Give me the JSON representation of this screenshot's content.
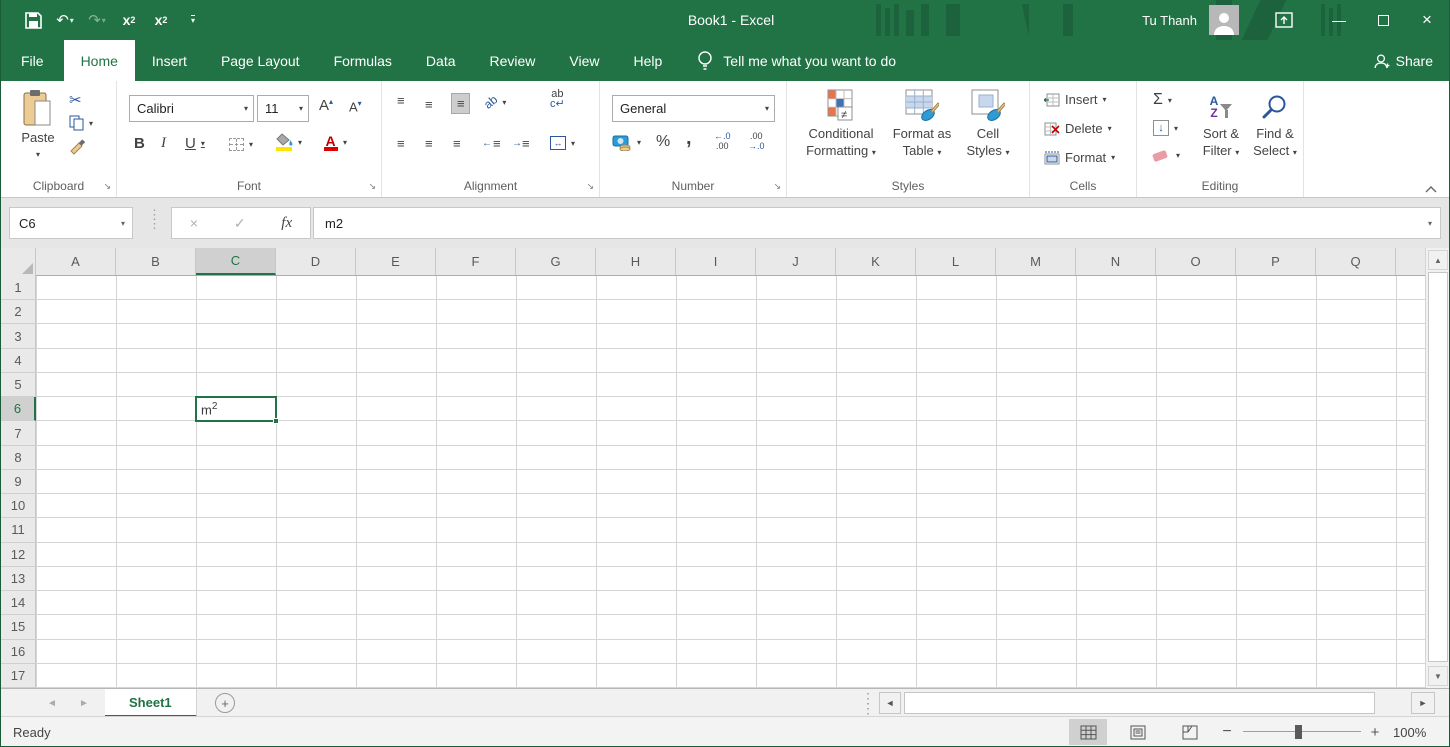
{
  "colors": {
    "brand": "#217346",
    "titlebar": "#217346",
    "fill_yellow": "#ffe400",
    "font_red": "#e00000",
    "blue_accent": "#2b579a",
    "purple_accent": "#7030a0"
  },
  "icons": [
    "save-icon",
    "undo-icon",
    "redo-icon",
    "subscript-icon",
    "superscript-icon",
    "qat-customize-icon",
    "avatar-icon",
    "ribbon-display-options-icon",
    "minimize-icon",
    "maximize-icon",
    "close-icon",
    "lightbulb-icon",
    "share-person-icon",
    "paste-clipboard-icon",
    "cut-scissors-icon",
    "copy-icon",
    "format-painter-icon",
    "grow-font-icon",
    "shrink-font-icon",
    "borders-icon",
    "fill-color-icon",
    "font-color-icon",
    "align-icons",
    "orientation-icon",
    "wrap-text-icon",
    "indent-icons",
    "merge-center-icon",
    "accounting-icon",
    "percent-icon",
    "comma-icon",
    "increase-decimal-icon",
    "decrease-decimal-icon",
    "conditional-formatting-icon",
    "format-as-table-icon",
    "cell-styles-icon",
    "insert-cells-icon",
    "delete-cells-icon",
    "format-cells-icon",
    "autosum-icon",
    "fill-down-icon",
    "clear-eraser-icon",
    "sort-filter-icon",
    "find-select-icon",
    "dropdown-arrow-icon",
    "dialog-launcher-icon",
    "collapse-ribbon-icon",
    "select-all-triangle-icon",
    "new-sheet-icon",
    "normal-view-icon",
    "page-layout-view-icon",
    "page-break-view-icon"
  ],
  "titlebar": {
    "title": "Book1  -  Excel",
    "user_name": "Tu Thanh",
    "qat_subscript": {
      "base": "x",
      "script": "2"
    },
    "qat_superscript": {
      "base": "x",
      "script": "2"
    }
  },
  "ribbon_tabs": {
    "items": [
      {
        "label": "File",
        "active": false
      },
      {
        "label": "Home",
        "active": true
      },
      {
        "label": "Insert",
        "active": false
      },
      {
        "label": "Page Layout",
        "active": false
      },
      {
        "label": "Formulas",
        "active": false
      },
      {
        "label": "Data",
        "active": false
      },
      {
        "label": "Review",
        "active": false
      },
      {
        "label": "View",
        "active": false
      },
      {
        "label": "Help",
        "active": false
      }
    ],
    "tell_me": "Tell me what you want to do",
    "share": "Share"
  },
  "ribbon": {
    "clipboard": {
      "label": "Clipboard",
      "paste": "Paste"
    },
    "font": {
      "label": "Font",
      "family": "Calibri",
      "size": "11",
      "bold": "B",
      "italic": "I",
      "underline": "U",
      "grow": "A",
      "shrink": "A",
      "font_color_letter": "A"
    },
    "alignment": {
      "label": "Alignment",
      "wrap_top": "ab",
      "wrap_bottom": "c↵",
      "orientation": "ab"
    },
    "number": {
      "label": "Number",
      "format": "General",
      "percent": "%",
      "comma": ",",
      "inc_top": "←.0",
      "inc_bottom": ".00",
      "dec_top": ".00",
      "dec_bottom": "→.0"
    },
    "styles": {
      "label": "Styles",
      "conditional_1": "Conditional",
      "conditional_2": "Formatting",
      "table_1": "Format as",
      "table_2": "Table",
      "cellstyles_1": "Cell",
      "cellstyles_2": "Styles"
    },
    "cells": {
      "label": "Cells",
      "insert": "Insert",
      "delete": "Delete",
      "format": "Format"
    },
    "editing": {
      "label": "Editing",
      "autosum": "Σ",
      "az_a": "A",
      "az_z": "Z",
      "sort_1": "Sort &",
      "sort_2": "Filter",
      "find_1": "Find &",
      "find_2": "Select"
    }
  },
  "formula_bar": {
    "name_box": "C6",
    "cancel": "×",
    "enter": "✓",
    "fx": "fx",
    "value": "m2"
  },
  "grid": {
    "columns": [
      "A",
      "B",
      "C",
      "D",
      "E",
      "F",
      "G",
      "H",
      "I",
      "J",
      "K",
      "L",
      "M",
      "N",
      "O",
      "P",
      "Q"
    ],
    "rows": [
      "1",
      "2",
      "3",
      "4",
      "5",
      "6",
      "7",
      "8",
      "9",
      "10",
      "11",
      "12",
      "13",
      "14",
      "15",
      "16",
      "17"
    ],
    "selected_column": "C",
    "selected_row": "6",
    "selected_cell_ref": "C6",
    "cell_value": {
      "base": "m",
      "sup": "2"
    }
  },
  "sheet_bar": {
    "active_tab": "Sheet1"
  },
  "status_bar": {
    "status": "Ready",
    "zoom_level": "100%"
  }
}
